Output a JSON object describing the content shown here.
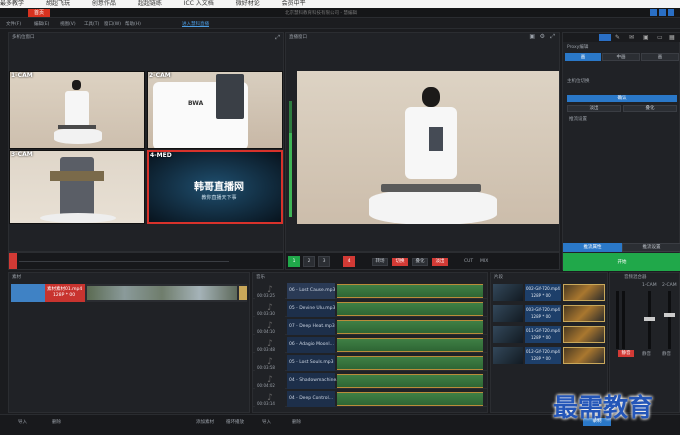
{
  "tabs": {
    "browser_bookmarks": [
      "最多教学",
      "胡超飞玩",
      "创意作品",
      "超超链练",
      "ICC 入文档",
      "微好材论",
      "会员中平"
    ]
  },
  "app": {
    "title": "北京慧科教育科技有限公司 - 慧编辑",
    "active_tab": "首页",
    "menu": [
      "文件(F)",
      "编辑(E)",
      "视图(V)",
      "工具(T)",
      "窗口(W)",
      "帮助(H)"
    ],
    "link": "进入慧科直播"
  },
  "preview": {
    "title": "多机位窗口",
    "cams": [
      "1-CAM",
      "2-CAM",
      "3-CAM",
      "4-MED"
    ],
    "med_text": "韩哥直播网",
    "med_sub": "教你直播天下事"
  },
  "program": {
    "title": "直播窗口"
  },
  "right": {
    "panel_title": "Proxy编辑",
    "tabs": [
      "画",
      "中画",
      "画"
    ],
    "label1": "主机位切换",
    "button_blue": "确认",
    "row": [
      "淡出",
      "叠化"
    ],
    "section": "推流设置",
    "bottom_left": "推流属性",
    "bottom_right": "推流设置",
    "start": "开始"
  },
  "controls": {
    "numbers": [
      "1",
      "2",
      "3",
      "4"
    ],
    "labels": [
      "转场",
      "切换",
      "叠化",
      "淡出"
    ],
    "cut": "CUT",
    "mix": "MIX"
  },
  "playlist": {
    "title": "素材",
    "active": "素材素材01.mp4",
    "sub": "128P * 00"
  },
  "audio": {
    "title": "音乐",
    "tracks": [
      {
        "name": "06 - Lost Cause.mp3",
        "time": "00:03:25"
      },
      {
        "name": "05 - Devine Ulu.mp3",
        "time": "00:03:30"
      },
      {
        "name": "07 - Deep Heat.mp3",
        "time": "00:04:10"
      },
      {
        "name": "06 - Adagio Moonl...",
        "time": "00:03:48"
      },
      {
        "name": "05 - Lost Souls.mp3",
        "time": "00:03:58"
      },
      {
        "name": "04 - Shadowmachine...",
        "time": "00:04:02"
      },
      {
        "name": "04 - Deep Control...",
        "time": "00:03:14"
      }
    ]
  },
  "clips": {
    "title": "片段",
    "items": [
      "002-Gif-720.mp4",
      "003-Gif-720.mp4",
      "011-Gif-720.mp4",
      "012-Gif-720.mp4"
    ],
    "sub": "128P * 00"
  },
  "mixer": {
    "title": "音频混合器",
    "channels": [
      "1-CAM",
      "2-CAM"
    ],
    "mute": "静音"
  },
  "footer": {
    "left": [
      "导入",
      "删除"
    ],
    "middle": [
      "添加素材",
      "循环播放"
    ],
    "right": [
      "导入",
      "删除"
    ],
    "rec": "录制"
  },
  "watermark": "最需教育"
}
